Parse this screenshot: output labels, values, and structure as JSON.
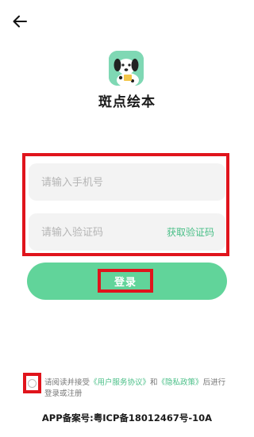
{
  "header": {
    "back_icon": "arrow-left-icon"
  },
  "app": {
    "name": "斑点绘本",
    "logo_icon": "dalmatian-dog-logo"
  },
  "login_form": {
    "phone_placeholder": "请输入手机号",
    "code_placeholder": "请输入验证码",
    "get_code_label": "获取验证码",
    "submit_label": "登录"
  },
  "agreement": {
    "prefix": "请阅读并接受",
    "user_agreement": "《用户服务协议》",
    "conjunction": "和",
    "privacy_policy": "《隐私政策》",
    "suffix": "后进行登录或注册"
  },
  "footer": {
    "icp": "APP备案号:粤ICP备18012467号-10A"
  },
  "colors": {
    "accent": "#61d49a",
    "link": "#49bf87",
    "highlight_frame": "#e0141c"
  }
}
